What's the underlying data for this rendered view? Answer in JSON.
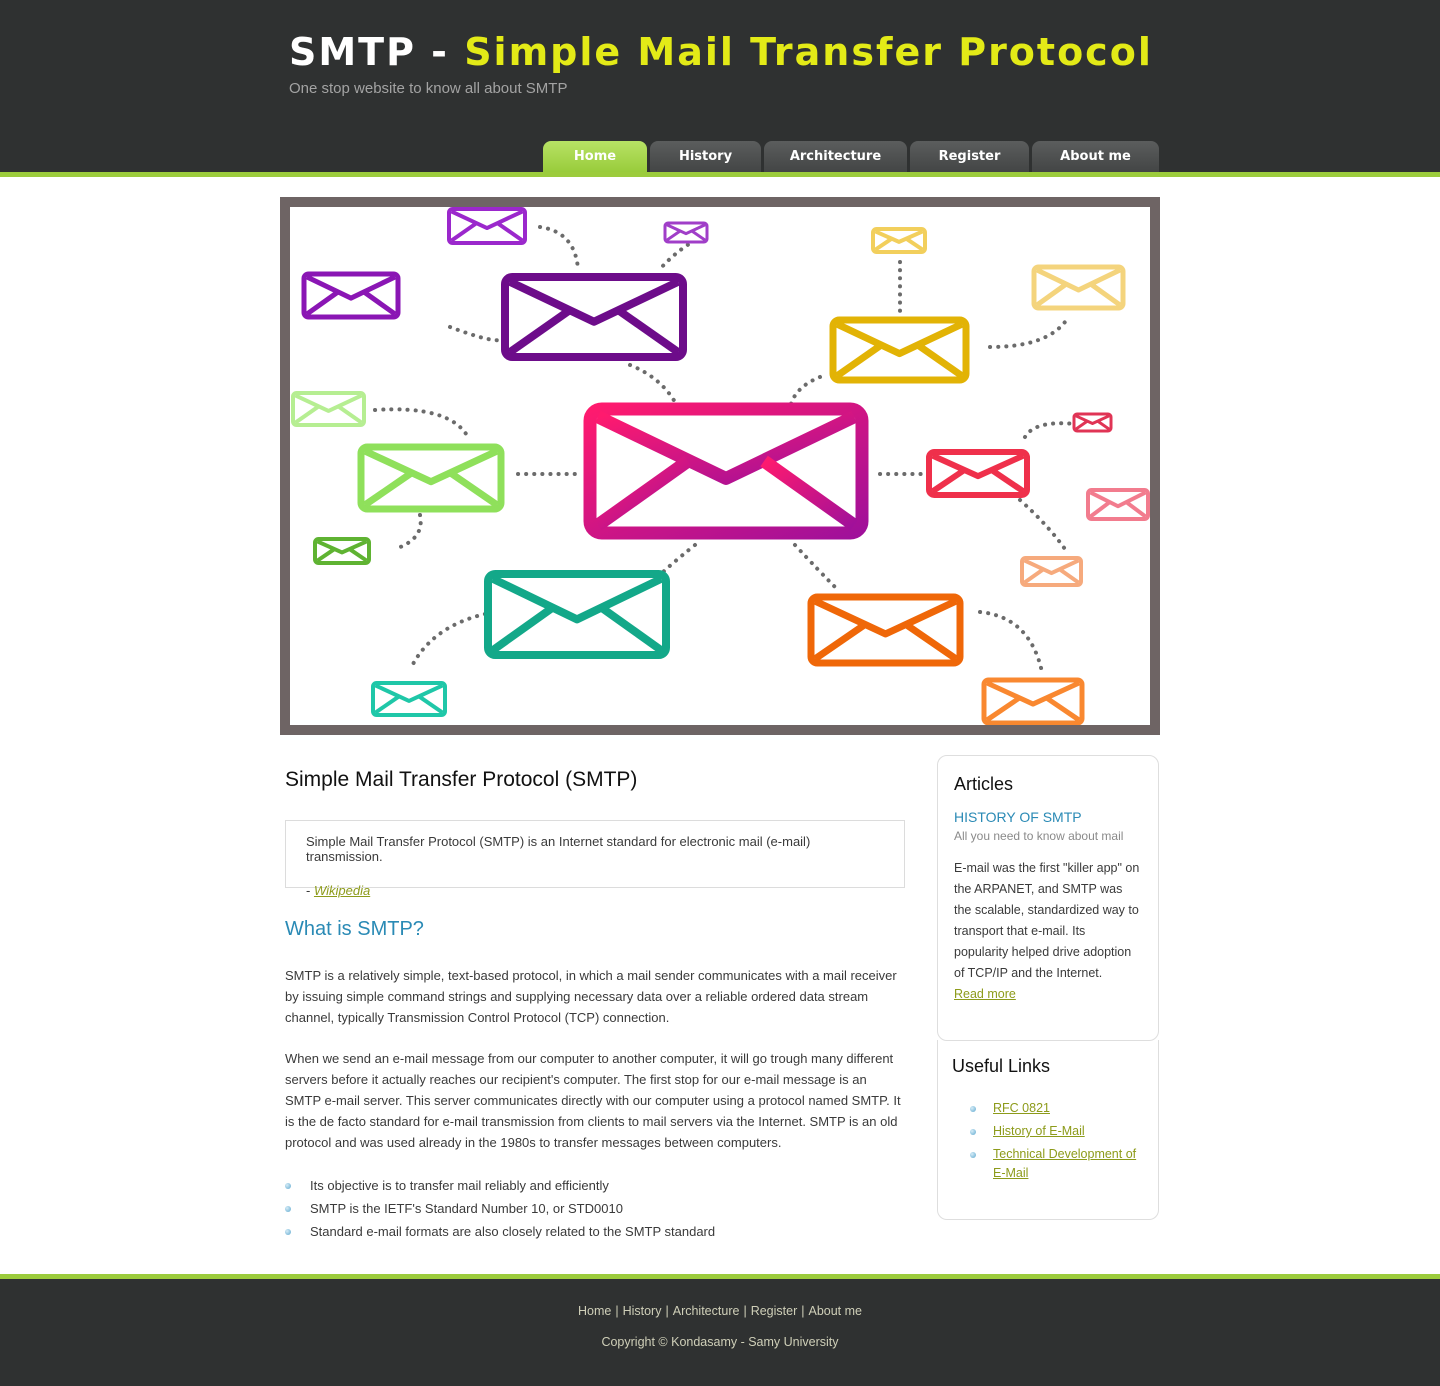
{
  "header": {
    "title_part1": "SMTP - ",
    "title_part2": "Simple Mail Transfer Protocol",
    "tagline": "One stop website to know all about SMTP"
  },
  "nav": [
    {
      "label": "Home",
      "active": true
    },
    {
      "label": "History",
      "active": false
    },
    {
      "label": "Architecture",
      "active": false
    },
    {
      "label": "Register",
      "active": false
    },
    {
      "label": "About me",
      "active": false
    }
  ],
  "banner": {
    "icon": "mail-network-illustration",
    "colors": {
      "center": "#e0177c",
      "purple": "#6d0c8a",
      "yellow": "#e2b305",
      "green": "#8fe05b",
      "teal": "#13a889",
      "orange": "#ef6708",
      "red": "#ef304b"
    }
  },
  "main": {
    "title": "Simple Mail Transfer Protocol (SMTP)",
    "quote": "Simple Mail Transfer Protocol (SMTP) is an Internet standard for electronic mail (e-mail) transmission.",
    "quote_prefix": "- ",
    "quote_source": "Wikipedia",
    "section_heading": "What is SMTP?",
    "para1": "SMTP is a relatively simple, text-based protocol, in which a mail sender communicates with a mail receiver by issuing simple command strings and supplying necessary data over a reliable ordered data stream channel, typically Transmission Control Protocol (TCP) connection.",
    "para2": "When we send an e-mail message from our computer to another computer, it will go trough many different servers before it actually reaches our recipient's computer. The first stop for our e-mail message is an SMTP e-mail server. This server communicates directly with our computer using a protocol named SMTP. It is the de facto standard for e-mail transmission from clients to mail servers via the Internet. SMTP is an old protocol and was used already in the 1980s to transfer messages between computers.",
    "bullets": [
      "Its objective is to transfer mail reliably and efficiently",
      "SMTP is the IETF's Standard Number 10, or STD0010",
      "Standard e-mail formats are also closely related to the SMTP standard"
    ]
  },
  "sidebar": {
    "articles_heading": "Articles",
    "article_title": "HISTORY OF SMTP",
    "article_subtitle": "All you need to know about mail",
    "article_text": "E-mail was the first \"killer app\" on the ARPANET, and SMTP was the scalable, standardized way to transport that e-mail. Its popularity helped drive adoption of TCP/IP and the Internet.",
    "read_more": "Read more",
    "links_heading": "Useful Links",
    "links": [
      "RFC 0821",
      "History of E-Mail",
      "Technical Development of E-Mail"
    ]
  },
  "footer": {
    "nav": [
      "Home",
      "History",
      "Architecture",
      "Register",
      "About me"
    ],
    "separator": "|",
    "copyright": "Copyright © Kondasamy - Samy University"
  },
  "theme": {
    "accent": "#9ccc3c",
    "header_bg": "#2f3131",
    "title_yellow": "#e3ea17",
    "link_olive": "#8d9b1a",
    "heading_blue": "#2a8ab5"
  }
}
